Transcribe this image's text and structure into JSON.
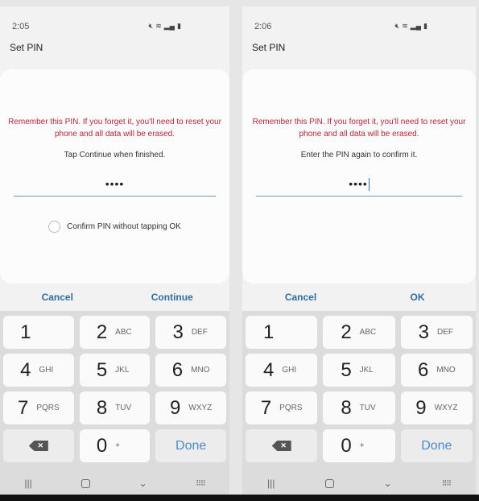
{
  "screens": [
    {
      "status": {
        "time": "2:05",
        "icons": [
          "mute-icon",
          "wifi-icon",
          "signal-icon",
          "battery-icon"
        ]
      },
      "title": "Set PIN",
      "warning": "Remember this PIN. If you forget it, you'll need to reset your phone and all data will be erased.",
      "hint": "Tap Continue when finished.",
      "pin_value": "••••",
      "option_label": "Confirm PIN without tapping OK",
      "cancel_label": "Cancel",
      "confirm_label": "Continue"
    },
    {
      "status": {
        "time": "2:06",
        "icons": [
          "mute-icon",
          "wifi-icon",
          "signal-icon",
          "battery-icon"
        ]
      },
      "title": "Set PIN",
      "warning": "Remember this PIN. If you forget it, you'll need to reset your phone and all data will be erased.",
      "hint": "Enter the PIN again to confirm it.",
      "pin_value": "••••",
      "cancel_label": "Cancel",
      "confirm_label": "OK"
    }
  ],
  "keypad": {
    "keys": [
      {
        "num": "1",
        "letters": ""
      },
      {
        "num": "2",
        "letters": "ABC"
      },
      {
        "num": "3",
        "letters": "DEF"
      },
      {
        "num": "4",
        "letters": "GHI"
      },
      {
        "num": "5",
        "letters": "JKL"
      },
      {
        "num": "6",
        "letters": "MNO"
      },
      {
        "num": "7",
        "letters": "PQRS"
      },
      {
        "num": "8",
        "letters": "TUV"
      },
      {
        "num": "9",
        "letters": "WXYZ"
      },
      {
        "num": "0",
        "letters": "+"
      }
    ],
    "done_label": "Done",
    "delete_glyph": "✕"
  },
  "nav": {
    "recents": "|||",
    "back": "⌄",
    "keyboard": "⠿⠿"
  }
}
